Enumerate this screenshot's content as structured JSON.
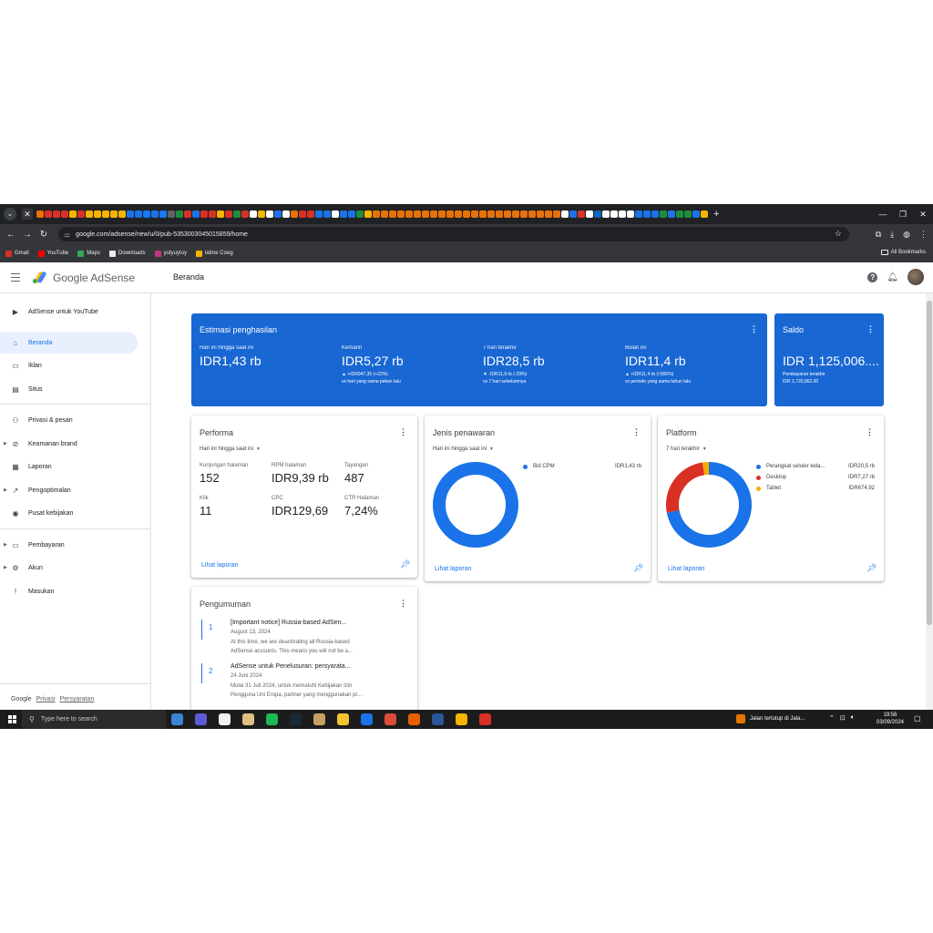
{
  "browser": {
    "url": "google.com/adsense/new/u/0/pub-5353003045015859/home",
    "bookmarks": [
      "Gmail",
      "YouTube",
      "Maps",
      "Downloads",
      "yutyuytuy",
      "latme Coeg"
    ],
    "all_bookmarks": "All Bookmarks",
    "favicon_colors": [
      "#e8710a",
      "#d93025",
      "#d93025",
      "#d93025",
      "#f4b400",
      "#d93025",
      "#f4b400",
      "#f4b400",
      "#f4b400",
      "#f4b400",
      "#f4b400",
      "#1a73e8",
      "#1a73e8",
      "#1877f2",
      "#1a73e8",
      "#1877f2",
      "#5f6368",
      "#1e8e3e",
      "#d93025",
      "#1a73e8",
      "#d93025",
      "#d93025",
      "#f4b400",
      "#d93025",
      "#1e8e3e",
      "#d93025",
      "#ffffff",
      "#f4b400",
      "#ffffff",
      "#1a73e8",
      "#ffffff",
      "#e8710a",
      "#d93025",
      "#d93025",
      "#1a73e8",
      "#1a73e8",
      "#ffffff",
      "#1a73e8",
      "#1a73e8",
      "#1e8e3e",
      "#f4b400",
      "#e8710a",
      "#e8710a",
      "#e8710a",
      "#e8710a",
      "#e8710a",
      "#e8710a",
      "#e8710a",
      "#e8710a",
      "#e8710a",
      "#e8710a",
      "#e8710a",
      "#e8710a",
      "#e8710a",
      "#e8710a",
      "#e8710a",
      "#e8710a",
      "#e8710a",
      "#e8710a",
      "#e8710a",
      "#e8710a",
      "#e8710a",
      "#e8710a",
      "#e8710a",
      "#ffffff",
      "#1a73e8",
      "#d93025",
      "#ffffff",
      "#0a66c2",
      "#ffffff",
      "#ffffff",
      "#ffffff",
      "#ffffff",
      "#1a73e8",
      "#1a73e8",
      "#1a73e8",
      "#1e8e3e",
      "#1a73e8",
      "#1e8e3e",
      "#1e8e3e",
      "#1a73e8",
      "#f4b400"
    ]
  },
  "app": {
    "product": "Google AdSense",
    "page_title": "Beranda"
  },
  "sidebar": {
    "youtube": "AdSense untuk YouTube",
    "items": [
      {
        "label": "Beranda",
        "icon": "home-icon",
        "glyph": "⌂"
      },
      {
        "label": "Iklan",
        "icon": "ads-icon",
        "glyph": "▭"
      },
      {
        "label": "Situs",
        "icon": "sites-icon",
        "glyph": "▤"
      },
      {
        "label": "Privasi & pesan",
        "icon": "privacy-icon",
        "glyph": "⚇"
      },
      {
        "label": "Keamanan brand",
        "icon": "block-icon",
        "glyph": "⊘"
      },
      {
        "label": "Laporan",
        "icon": "reports-icon",
        "glyph": "▦"
      },
      {
        "label": "Pengoptimalan",
        "icon": "trending-icon",
        "glyph": "↗"
      },
      {
        "label": "Pusat kebijakan",
        "icon": "policy-icon",
        "glyph": "◉"
      },
      {
        "label": "Pembayaran",
        "icon": "payments-icon",
        "glyph": "▭"
      },
      {
        "label": "Akun",
        "icon": "settings-icon",
        "glyph": "⚙"
      },
      {
        "label": "Masukan",
        "icon": "feedback-icon",
        "glyph": "!"
      }
    ],
    "footer": {
      "google": "Google",
      "privacy": "Privasi",
      "terms": "Persyaratan"
    }
  },
  "earnings": {
    "title": "Estimasi penghasilan",
    "metrics": [
      {
        "label": "Hari ini hingga saat ini",
        "value": "IDR1,43 rb",
        "delta": "",
        "compare": ""
      },
      {
        "label": "Kemarin",
        "value": "IDR5,27 rb",
        "delta": "▲ +IDR947,35 (+22%)",
        "compare": "vs hari yang sama pekan lalu"
      },
      {
        "label": "7 hari terakhir",
        "value": "IDR28,5 rb",
        "delta": "▼ -IDR11,9 rb (-29%)",
        "compare": "vs 7 hari sebelumnya"
      },
      {
        "label": "Bulan ini",
        "value": "IDR11,4 rb",
        "delta": "▲ +IDR11,4 rb (≈500%)",
        "compare": "vs periode yang sama tahun lalu"
      }
    ]
  },
  "balance": {
    "title": "Saldo",
    "value": "IDR 1,125,006....",
    "last_label": "Pembayaran terakhir",
    "last_value": "IDR 1,720,062.00"
  },
  "performance": {
    "title": "Performa",
    "range": "Hari ini hingga saat ini",
    "stats": [
      {
        "label": "Kunjungan halaman",
        "value": "152"
      },
      {
        "label": "RPM halaman",
        "value": "IDR9,39 rb"
      },
      {
        "label": "Tayangan",
        "value": "487"
      },
      {
        "label": "Klik",
        "value": "11"
      },
      {
        "label": "CPC",
        "value": "IDR129,69"
      },
      {
        "label": "CTR Halaman",
        "value": "7,24%"
      }
    ],
    "link": "Lihat laporan"
  },
  "bid_types": {
    "title": "Jenis penawaran",
    "range": "Hari ini hingga saat ini",
    "link": "Lihat laporan",
    "chart_data": {
      "type": "pie",
      "categories": [
        "Bid CPM"
      ],
      "values": [
        1430
      ],
      "value_labels": [
        "IDR1,43 rb"
      ],
      "colors": [
        "#1a73e8"
      ]
    }
  },
  "platform": {
    "title": "Platform",
    "range": "7 hari terakhir",
    "link": "Lihat laporan",
    "chart_data": {
      "type": "pie",
      "categories": [
        "Perangkat seluler kela...",
        "Desktop",
        "Tablet"
      ],
      "values": [
        20500,
        7270,
        674.92
      ],
      "value_labels": [
        "IDR20,5 rb",
        "IDR7,27 rb",
        "IDR674,92"
      ],
      "colors": [
        "#1a73e8",
        "#d93025",
        "#f9ab00"
      ]
    }
  },
  "announcements": {
    "title": "Pengumuman",
    "items": [
      {
        "num": "1",
        "title": "[Important notice] Russia-based AdSen...",
        "date": "August 13, 2024",
        "text1": "At this time, we are deactivating all Russia-based",
        "text2": "AdSense accounts. This means you will not be a..."
      },
      {
        "num": "2",
        "title": "AdSense untuk Penelusuran: persyarata...",
        "date": "24 Juni 2024",
        "text1": "Mulai 31 Juli 2024, untuk mematuhi Kebijakan Izin",
        "text2": "Pengguna Uni Eropa, partner yang menggunakan pr..."
      }
    ]
  },
  "taskbar": {
    "search_placeholder": "Type here to search",
    "news": "Jalan tertutup di Jala...",
    "time": "19:56",
    "date": "03/09/2024",
    "app_colors": [
      "#3a86d4",
      "#5b5bd6",
      "#f0f0f0",
      "#e0c080",
      "#1db954",
      "#1b2838",
      "#c8a060",
      "#f4c430",
      "#1a73e8",
      "#dd4b39",
      "#e66000",
      "#2b5797",
      "#f4b400",
      "#d93025"
    ]
  }
}
